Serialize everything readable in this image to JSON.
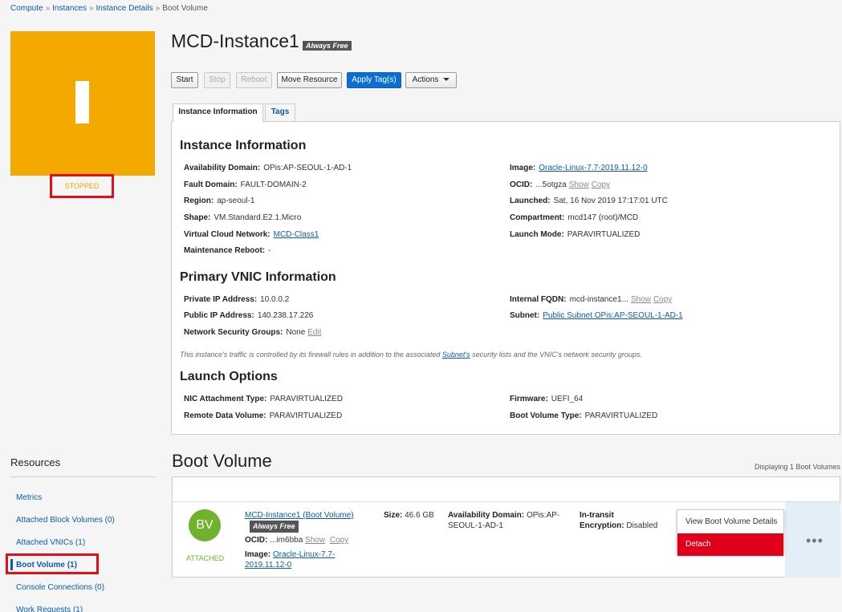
{
  "breadcrumb": {
    "items": [
      "Compute",
      "Instances",
      "Instance Details"
    ],
    "current": "Boot Volume",
    "separator": "»"
  },
  "instance": {
    "name": "MCD-Instance1",
    "badge": "Always Free",
    "tile_letter": "I",
    "state": "STOPPED",
    "tile_color": "#f4a900"
  },
  "buttons": {
    "start": "Start",
    "stop": "Stop",
    "reboot": "Reboot",
    "move": "Move Resource",
    "apply_tags": "Apply Tag(s)",
    "actions": "Actions"
  },
  "tabs": {
    "info": "Instance Information",
    "tags": "Tags"
  },
  "instance_info": {
    "heading": "Instance Information",
    "availability_domain": {
      "label": "Availability Domain:",
      "value": "OPis:AP-SEOUL-1-AD-1"
    },
    "fault_domain": {
      "label": "Fault Domain:",
      "value": "FAULT-DOMAIN-2"
    },
    "region": {
      "label": "Region:",
      "value": "ap-seoul-1"
    },
    "shape": {
      "label": "Shape:",
      "value": "VM.Standard.E2.1.Micro"
    },
    "vcn": {
      "label": "Virtual Cloud Network:",
      "value": "MCD-Class1"
    },
    "maintenance": {
      "label": "Maintenance Reboot:",
      "value": "-"
    },
    "image": {
      "label": "Image:",
      "value": "Oracle-Linux-7.7-2019.11.12-0"
    },
    "ocid": {
      "label": "OCID:",
      "value": "...5otgza",
      "show": "Show",
      "copy": "Copy"
    },
    "launched": {
      "label": "Launched:",
      "value": "Sat, 16 Nov 2019 17:17:01 UTC"
    },
    "compartment": {
      "label": "Compartment:",
      "value": "mcd147 (root)/MCD"
    },
    "launch_mode": {
      "label": "Launch Mode:",
      "value": "PARAVIRTUALIZED"
    }
  },
  "vnic": {
    "heading": "Primary VNIC Information",
    "private_ip": {
      "label": "Private IP Address:",
      "value": "10.0.0.2"
    },
    "public_ip": {
      "label": "Public IP Address:",
      "value": "140.238.17.226"
    },
    "nsg": {
      "label": "Network Security Groups:",
      "value": "None",
      "edit": "Edit"
    },
    "fqdn": {
      "label": "Internal FQDN:",
      "value": "mcd-instance1...",
      "show": "Show",
      "copy": "Copy"
    },
    "subnet": {
      "label": "Subnet:",
      "value": "Public Subnet OPis:AP-SEOUL-1-AD-1"
    },
    "note_before": "This instance's traffic is controlled by its firewall rules in addition to the associated ",
    "note_link": "Subnet's",
    "note_after": " security lists and the VNIC's network security groups."
  },
  "launch_options": {
    "heading": "Launch Options",
    "nic_type": {
      "label": "NIC Attachment Type:",
      "value": "PARAVIRTUALIZED"
    },
    "remote_data": {
      "label": "Remote Data Volume:",
      "value": "PARAVIRTUALIZED"
    },
    "firmware": {
      "label": "Firmware:",
      "value": "UEFI_64"
    },
    "boot_volume_type": {
      "label": "Boot Volume Type:",
      "value": "PARAVIRTUALIZED"
    }
  },
  "resources": {
    "title": "Resources",
    "items": [
      "Metrics",
      "Attached Block Volumes (0)",
      "Attached VNICs (1)",
      "Boot Volume (1)",
      "Console Connections (0)",
      "Work Requests (1)"
    ]
  },
  "boot_volume": {
    "title": "Boot Volume",
    "count_text": "Displaying 1 Boot Volumes",
    "icon_text": "BV",
    "icon_color": "#6fb22c",
    "status": "ATTACHED",
    "name": "MCD-Instance1 (Boot Volume)",
    "badge": "Always Free",
    "ocid_label": "OCID:",
    "ocid_value": "...im6bba",
    "show": "Show",
    "copy": "Copy",
    "image_label": "Image:",
    "image_line1": "Oracle-Linux-7.7-",
    "image_line2": "2019.11.12-0",
    "size_label": "Size:",
    "size_value": "46.6 GB",
    "ad_label": "Availability Domain:",
    "ad_line1": "OPis:AP-",
    "ad_line2": "SEOUL-1-AD-1",
    "enc_label1": "In-transit",
    "enc_label2": "Encryption:",
    "enc_value": "Disabled",
    "kebab": "•••",
    "menu": {
      "view": "View Boot Volume Details",
      "detach": "Detach"
    }
  }
}
